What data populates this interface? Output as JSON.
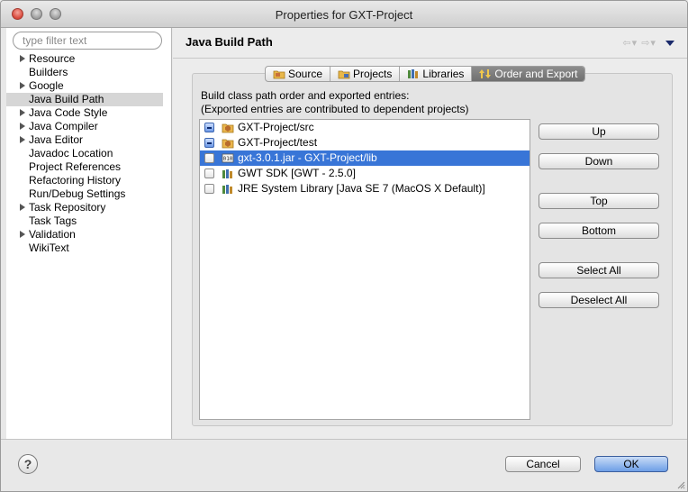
{
  "window": {
    "title": "Properties for GXT-Project"
  },
  "filter": {
    "placeholder": "type filter text"
  },
  "sidebar": {
    "items": [
      {
        "label": "Resource",
        "expandable": true
      },
      {
        "label": "Builders",
        "expandable": false
      },
      {
        "label": "Google",
        "expandable": true
      },
      {
        "label": "Java Build Path",
        "expandable": false,
        "selected": true
      },
      {
        "label": "Java Code Style",
        "expandable": true
      },
      {
        "label": "Java Compiler",
        "expandable": true
      },
      {
        "label": "Java Editor",
        "expandable": true
      },
      {
        "label": "Javadoc Location",
        "expandable": false
      },
      {
        "label": "Project References",
        "expandable": false
      },
      {
        "label": "Refactoring History",
        "expandable": false
      },
      {
        "label": "Run/Debug Settings",
        "expandable": false
      },
      {
        "label": "Task Repository",
        "expandable": true
      },
      {
        "label": "Task Tags",
        "expandable": false
      },
      {
        "label": "Validation",
        "expandable": true
      },
      {
        "label": "WikiText",
        "expandable": false
      }
    ]
  },
  "main": {
    "title": "Java Build Path",
    "tabs": [
      {
        "label": "Source",
        "icon": "source-folder-icon",
        "active": false
      },
      {
        "label": "Projects",
        "icon": "projects-icon",
        "active": false
      },
      {
        "label": "Libraries",
        "icon": "libraries-icon",
        "active": false
      },
      {
        "label": "Order and Export",
        "icon": "order-export-icon",
        "active": true
      }
    ],
    "description_line1": "Build class path order and exported entries:",
    "description_line2": "(Exported entries are contributed to dependent projects)",
    "entries": [
      {
        "label": "GXT-Project/src",
        "icon": "package-folder-icon",
        "check": "mixed",
        "selected": false
      },
      {
        "label": "GXT-Project/test",
        "icon": "package-folder-icon",
        "check": "mixed",
        "selected": false
      },
      {
        "label": "gxt-3.0.1.jar - GXT-Project/lib",
        "icon": "jar-icon",
        "check": "unchecked",
        "selected": true
      },
      {
        "label": "GWT SDK [GWT - 2.5.0]",
        "icon": "library-icon",
        "check": "unchecked",
        "selected": false
      },
      {
        "label": "JRE System Library [Java SE 7 (MacOS X Default)]",
        "icon": "library-icon",
        "check": "unchecked",
        "selected": false
      }
    ],
    "buttons": {
      "up": "Up",
      "down": "Down",
      "top": "Top",
      "bottom": "Bottom",
      "select_all": "Select All",
      "deselect_all": "Deselect All"
    }
  },
  "footer": {
    "help": "?",
    "cancel": "Cancel",
    "ok": "OK"
  },
  "colors": {
    "selection": "#3875d7",
    "sidebar_selection": "#d6d6d6",
    "active_tab": "#7d7d7d",
    "default_button": "#6d9ee6"
  }
}
